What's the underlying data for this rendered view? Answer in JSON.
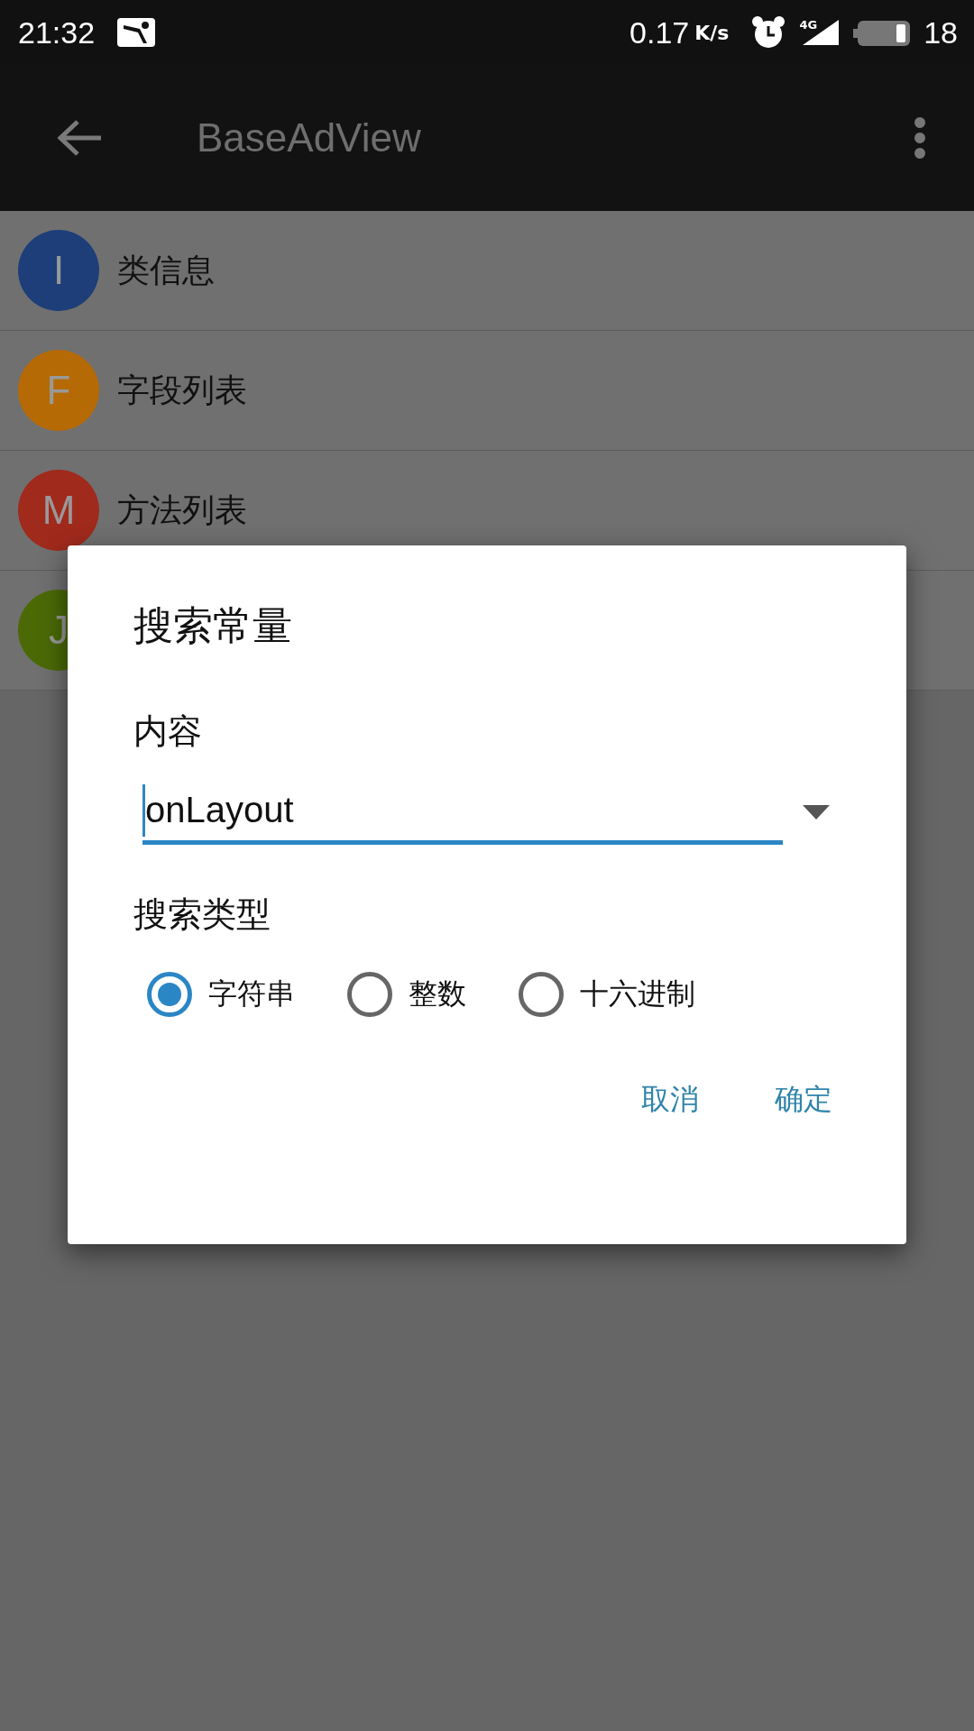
{
  "status_bar": {
    "time": "21:32",
    "speed": "0.17",
    "speed_unit": "K/s",
    "network": "4G",
    "battery": "18"
  },
  "toolbar": {
    "title": "BaseAdView"
  },
  "list": [
    {
      "letter": "I",
      "label": "类信息",
      "color": "#1d3e78"
    },
    {
      "letter": "F",
      "label": "字段列表",
      "color": "#b56a05"
    },
    {
      "letter": "M",
      "label": "方法列表",
      "color": "#a02a1c"
    },
    {
      "letter": "J",
      "color": "#4b6a06"
    }
  ],
  "dialog": {
    "title": "搜索常量",
    "content_label": "内容",
    "input": {
      "value": "onLayout"
    },
    "type_label": "搜索类型",
    "radios": [
      {
        "label": "字符串",
        "selected": true
      },
      {
        "label": "整数",
        "selected": false
      },
      {
        "label": "十六进制",
        "selected": false
      }
    ],
    "buttons": [
      "取消",
      "确定"
    ]
  }
}
